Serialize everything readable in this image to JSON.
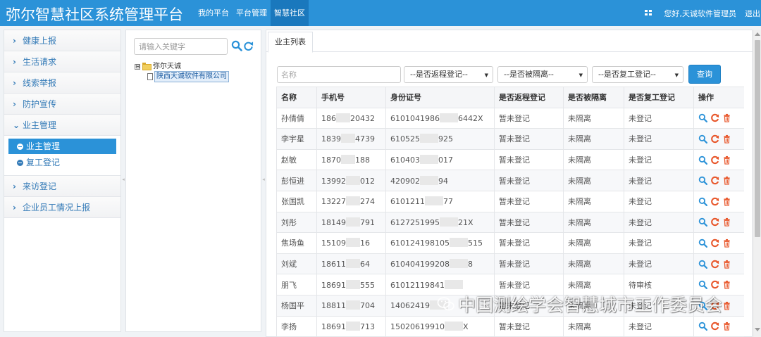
{
  "app": {
    "title": "弥尔智慧社区系统管理平台",
    "nav": [
      "我的平台",
      "平台管理",
      "智慧社区"
    ],
    "active_nav": 2,
    "greeting": "您好,天诚软件管理员",
    "logout": "退出",
    "accent_color": "#2b92d8"
  },
  "sidebar": {
    "items_top": [
      {
        "label": "健康上报",
        "icon": "chevron-right-icon"
      },
      {
        "label": "生活请求",
        "icon": "chevron-right-icon"
      },
      {
        "label": "线索举报",
        "icon": "chevron-right-icon"
      },
      {
        "label": "防护宣传",
        "icon": "chevron-right-icon"
      }
    ],
    "expanded": {
      "label": "业主管理",
      "icon": "chevron-down-icon"
    },
    "sub_items": [
      {
        "label": "业主管理",
        "active": true
      },
      {
        "label": "复工登记",
        "active": false
      }
    ],
    "items_bottom": [
      {
        "label": "来访登记",
        "icon": "chevron-right-icon"
      },
      {
        "label": "企业员工情况上报",
        "icon": "chevron-right-icon"
      }
    ]
  },
  "tree": {
    "search_placeholder": "请输入关键字",
    "root": "弥尔天诚",
    "root_toggle": "⊟",
    "child": "陕西天诚软件有限公司"
  },
  "main": {
    "tab": "业主列表",
    "filters": {
      "name_placeholder": "名称",
      "return_reg": "--是否返程登记--",
      "isolated": "--是否被隔离--",
      "work_reg": "--是否复工登记--",
      "query": "查询"
    },
    "columns": [
      "名称",
      "手机号",
      "身份证号",
      "是否返程登记",
      "是否被隔离",
      "是否复工登记",
      "操作"
    ],
    "rows": [
      {
        "name": "孙倩倩",
        "phone": [
          "186",
          "20432"
        ],
        "id": [
          "6101041986",
          "6442X"
        ],
        "return_reg": "暂未登记",
        "isolated": "未隔离",
        "work_reg": "未登记"
      },
      {
        "name": "李宇星",
        "phone": [
          "1839",
          "4739"
        ],
        "id": [
          "610525",
          "925"
        ],
        "return_reg": "暂未登记",
        "isolated": "未隔离",
        "work_reg": "未登记"
      },
      {
        "name": "赵敏",
        "phone": [
          "1870",
          "188"
        ],
        "id": [
          "610403",
          "017"
        ],
        "return_reg": "暂未登记",
        "isolated": "未隔离",
        "work_reg": "未登记"
      },
      {
        "name": "彭恒进",
        "phone": [
          "13992",
          "012"
        ],
        "id": [
          "420902",
          "94"
        ],
        "return_reg": "暂未登记",
        "isolated": "未隔离",
        "work_reg": "未登记"
      },
      {
        "name": "张国凯",
        "phone": [
          "13227",
          "274"
        ],
        "id": [
          "6101211",
          "77"
        ],
        "return_reg": "暂未登记",
        "isolated": "未隔离",
        "work_reg": "未登记"
      },
      {
        "name": "刘彤",
        "phone": [
          "18149",
          "791"
        ],
        "id": [
          "6127251995",
          "21X"
        ],
        "return_reg": "暂未登记",
        "isolated": "未隔离",
        "work_reg": "未登记"
      },
      {
        "name": "焦场鱼",
        "phone": [
          "15109",
          "16"
        ],
        "id": [
          "610124198105",
          "515"
        ],
        "return_reg": "暂未登记",
        "isolated": "未隔离",
        "work_reg": "未登记"
      },
      {
        "name": "刘斌",
        "phone": [
          "18611",
          "64"
        ],
        "id": [
          "610404199208",
          "8"
        ],
        "return_reg": "暂未登记",
        "isolated": "未隔离",
        "work_reg": "未登记"
      },
      {
        "name": "朋飞",
        "phone": [
          "18691",
          "555"
        ],
        "id": [
          "61012119841",
          ""
        ],
        "return_reg": "暂未登记",
        "isolated": "未隔离",
        "work_reg": "待审核"
      },
      {
        "name": "杨国平",
        "phone": [
          "18811",
          "704"
        ],
        "id": [
          "14062419",
          ""
        ],
        "return_reg": "暂未登记",
        "isolated": "未隔离",
        "work_reg": "未登记"
      },
      {
        "name": "李扬",
        "phone": [
          "18691",
          "713"
        ],
        "id": [
          "15020619910",
          "X"
        ],
        "return_reg": "暂未登记",
        "isolated": "未隔离",
        "work_reg": "未登记"
      }
    ],
    "row_actions": [
      {
        "icon": "search-icon",
        "color": "#2b92d8"
      },
      {
        "icon": "refresh-icon",
        "color": "#e8562a"
      },
      {
        "icon": "trash-icon",
        "color": "#e8562a"
      }
    ]
  },
  "watermark": "中国测绘学会智慧城市工作委员会"
}
